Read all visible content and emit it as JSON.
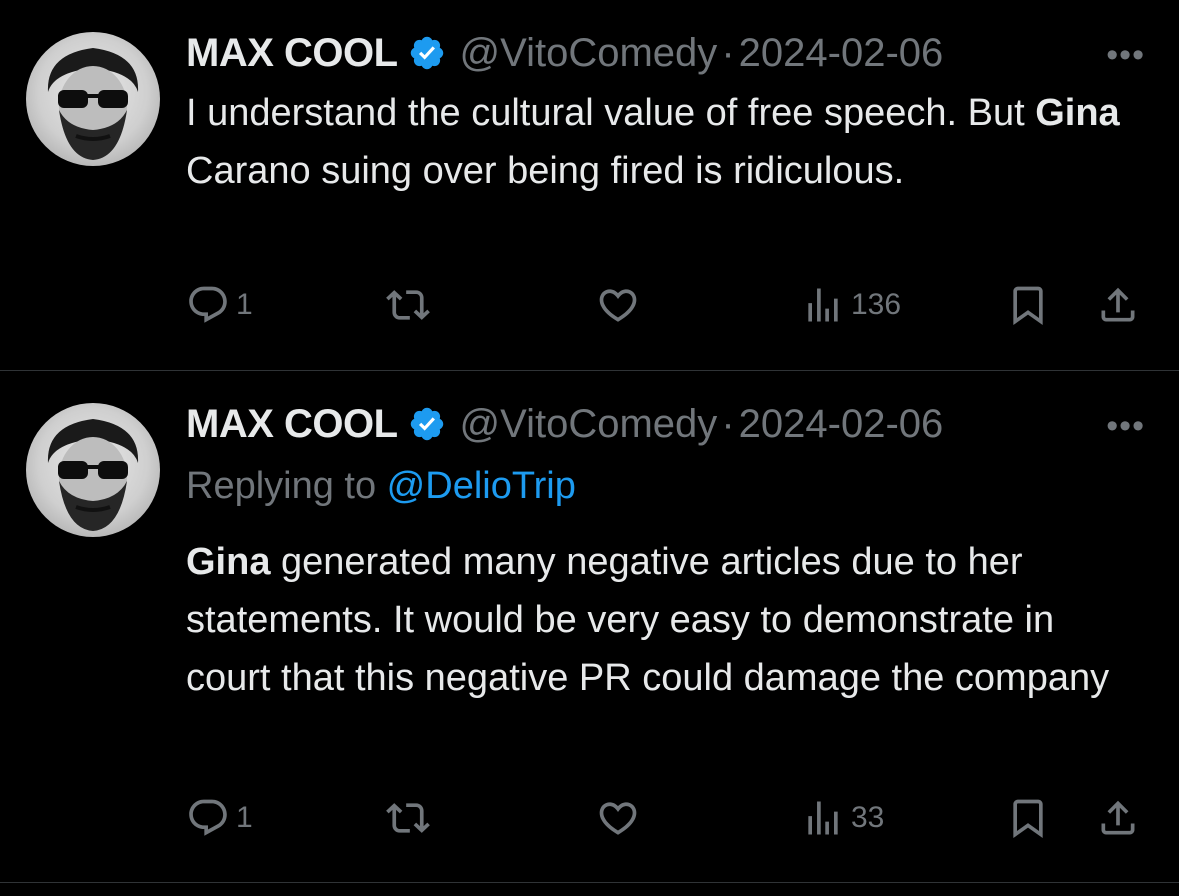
{
  "tweets": [
    {
      "author_name": "MAX COOL",
      "handle": "@VitoComedy",
      "separator": "·",
      "date": "2024-02-06",
      "more": "•••",
      "text_before": "I understand the cultural value of free speech. But ",
      "text_bold": "Gina",
      "text_after": " Carano suing over being fired is ridiculous.",
      "replies": "1",
      "views": "136"
    },
    {
      "author_name": "MAX COOL",
      "handle": "@VitoComedy",
      "separator": "·",
      "date": "2024-02-06",
      "more": "•••",
      "replying_prefix": "Replying to ",
      "replying_mention": "@DelioTrip",
      "text_bold": "Gina",
      "text_after": " generated many negative articles due to her statements. It would be very easy to demonstrate in court that this negative PR could damage the company",
      "replies": "1",
      "views": "33"
    }
  ],
  "colors": {
    "background": "#000000",
    "text": "#e7e9ea",
    "muted": "#71767b",
    "accent": "#1d9bf0",
    "divider": "#2f3336"
  },
  "icons": [
    "reply-icon",
    "retweet-icon",
    "like-icon",
    "views-icon",
    "bookmark-icon",
    "share-icon",
    "verified-badge-icon"
  ]
}
